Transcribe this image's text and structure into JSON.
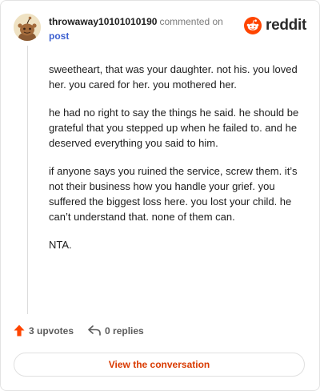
{
  "header": {
    "username": "throwaway10101010190",
    "action_text": "commented on",
    "post_link": "post"
  },
  "brand": {
    "wordmark": "reddit",
    "logo_icon": "reddit-alien-icon",
    "accent_color": "#ff4500"
  },
  "comment": {
    "paragraphs": [
      "sweetheart, that was your daughter. not his. you loved her. you cared for her. you mothered her.",
      "he had no right to say the things he said. he should be grateful that you stepped up when he failed to. and he deserved everything you said to him.",
      "if anyone says you ruined the service, screw them. it’s not their business how you handle your grief. you suffered the biggest loss here. you lost your child. he can’t understand that. none of them can.",
      "NTA."
    ]
  },
  "actions": {
    "upvotes_label": "3 upvotes",
    "upvote_icon": "upvote-arrow-icon",
    "replies_label": "0 replies",
    "reply_icon": "reply-arrow-icon"
  },
  "footer": {
    "button_label": "View the conversation",
    "button_color": "#d93a00"
  }
}
